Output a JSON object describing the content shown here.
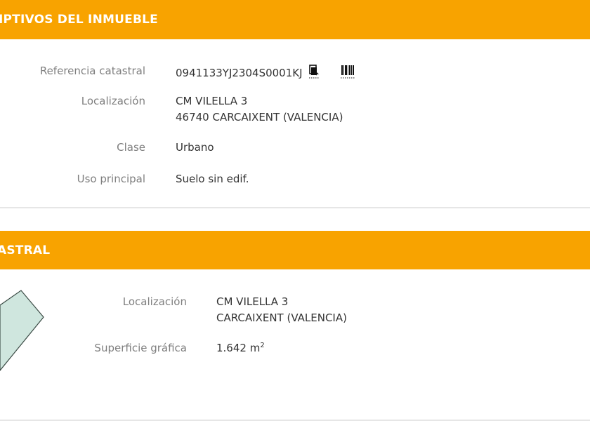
{
  "section1": {
    "title": "IPTIVOS DEL INMUEBLE",
    "rows": [
      {
        "label": "Referencia catastral",
        "value": "0941133YJ2304S0001KJ"
      },
      {
        "label": "Localización",
        "lines": [
          "CM VILELLA 3",
          "46740 CARCAIXENT (VALENCIA)"
        ]
      },
      {
        "label": "Clase",
        "value": "Urbano"
      },
      {
        "label": "Uso principal",
        "value": "Suelo sin edif."
      }
    ],
    "icons": [
      "copy-document-icon",
      "barcode-icon"
    ]
  },
  "section2": {
    "title": "ASTRAL",
    "rows": [
      {
        "label": "Localización",
        "lines": [
          "CM VILELLA 3",
          "CARCAIXENT (VALENCIA)"
        ]
      },
      {
        "label": "Superficie gráfica",
        "value": "1.642 m",
        "unit_sup": "2"
      }
    ],
    "parcel_color": "#cfe6de"
  },
  "colors": {
    "header_bg": "#f8a300",
    "header_text": "#ffffff",
    "label": "#7f7f7f",
    "value": "#333333"
  }
}
